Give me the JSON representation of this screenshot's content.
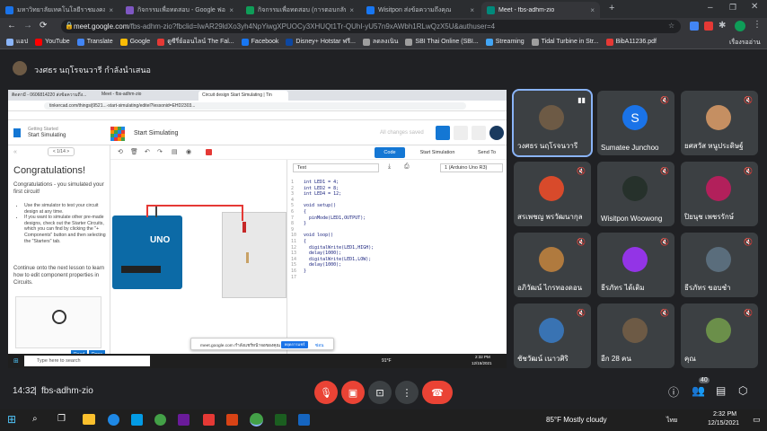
{
  "browser": {
    "tabs": [
      {
        "title": "มหาวิทยาลัยเทคโนโลยีราชมงคลศรีวิชัย",
        "color": "#1a73e8"
      },
      {
        "title": "กิจกรรมเพื่อทดสอบ - Google ฟอร์ม",
        "color": "#7e57c2"
      },
      {
        "title": "กิจกรรมเพื่อทดสอบ (การตอบกลับ) - Go",
        "color": "#0f9d58"
      },
      {
        "title": "Wisitpon ส่งข้อความถึงคุณ",
        "color": "#1877f2"
      },
      {
        "title": "Meet - fbs-adhm-zio",
        "color": "#00897b"
      }
    ],
    "new_tab": "+",
    "url_host": "meet.google.com",
    "url_path": "/fbs-adhm-zio?fbclid=IwAR29ldXo3yh4NpYiwgXPUOCy3XHUQt1Tr-QUhI-yU57n9xAWbh1RLwQzX5U&authuser=4",
    "bookmarks": [
      {
        "label": "แอป",
        "color": "#8ab4f8"
      },
      {
        "label": "YouTube",
        "color": "#ff0000"
      },
      {
        "label": "Translate",
        "color": "#4285f4"
      },
      {
        "label": "Google",
        "color": "#fbbc05"
      },
      {
        "label": "ดูซีรี่ย์ออนไลน์ The Fal...",
        "color": "#e53935"
      },
      {
        "label": "Facebook",
        "color": "#1877f2"
      },
      {
        "label": "Disney+ Hotstar ฟรี...",
        "color": "#0d47a1"
      },
      {
        "label": "ลดลงเนิน",
        "color": "#9e9e9e"
      },
      {
        "label": "SBI Thai Online (SBI...",
        "color": "#9e9e9e"
      },
      {
        "label": "Streaming",
        "color": "#42a5f5"
      },
      {
        "label": "Tidal Turbine in Str...",
        "color": "#9e9e9e"
      },
      {
        "label": "BibA11236.pdf",
        "color": "#e53935"
      }
    ],
    "reading_list": "เรื่องรออ่าน"
  },
  "meet": {
    "presenter_banner": "วงศธร นฤโรจนวารี กำลังนำเสนอ",
    "time": "14:32",
    "meeting_code": "fbs-adhm-zio",
    "participant_count": "40",
    "participants": [
      {
        "name": "วงศธร นฤโรจนวารี",
        "avatar": "photo",
        "color": "#6d5a45",
        "speaking": true
      },
      {
        "name": "Sumatee Junchoo",
        "avatar": "S",
        "color": "#1a73e8"
      },
      {
        "name": "ยศสวัส หนูประดิษฐ์",
        "avatar": "photo",
        "color": "#c58f62"
      },
      {
        "name": "สรเพชญ พรวัฒนากุล",
        "avatar": "photo",
        "color": "#d84a2b"
      },
      {
        "name": "Wisitpon Woowong",
        "avatar": "photo",
        "color": "#26312b"
      },
      {
        "name": "ปิยนุช เพชรรักษ์",
        "avatar": "photo",
        "color": "#b2205b"
      },
      {
        "name": "อภิวัฒน์ ไกรทองดอน",
        "avatar": "photo",
        "color": "#b07a3e"
      },
      {
        "name": "ธีรภัทร ได้เติม",
        "avatar": "photo",
        "color": "#9334e6"
      },
      {
        "name": "ธีรภัทร ขอบชำ",
        "avatar": "photo",
        "color": "#5a6d7c"
      },
      {
        "name": "ชัชวัฒน์ เนาวศิริ",
        "avatar": "photo",
        "color": "#3973b3"
      },
      {
        "name": "อีก 28 คน",
        "avatar": "photo",
        "color": "#6d5a45"
      },
      {
        "name": "คุณ",
        "avatar": "photo",
        "color": "#6b8f4a"
      }
    ]
  },
  "shared": {
    "tabs": [
      {
        "title": "ติดตามี - 0606814220 ส่งข้อความถึง..."
      },
      {
        "title": "Meet - fbs-adhm-zio"
      },
      {
        "title": "Circuit design Start Simulating | Tin"
      }
    ],
    "url": "tinkercad.com/things/j9521...-start-simulating/editel?lessonid=EHD2303...",
    "lesson_label": "Getting Started",
    "lesson_sub": "Start Simulating",
    "project_title": "Start Simulating",
    "saved_status": "All changes saved",
    "page_counter": "< 1/14 >",
    "lesson_heading": "Congratulations!",
    "lesson_intro": "Congratulations - you simulated your first circuit!",
    "bullets": [
      "Use the simulator to test your circuit design at any time.",
      "If you want to simulate other pre-made designs, check out the Starter Circuits, which you can find by clicking the \"+ Components\" button and then selecting the \"Starters\" tab."
    ],
    "lesson_footer": "Continue onto the next lesson to learn how to edit component properties in Circuits.",
    "btn_read": "Read",
    "btn_done": "Done",
    "btn_code": "Code",
    "btn_simulate": "Start Simulation",
    "btn_send": "Send To",
    "code_mode": "Text",
    "board": "1 (Arduino Uno R3)",
    "arduino_label": "UNO",
    "code_lines": [
      "int LED1 = 4;",
      "int LED2 = 8;",
      "int LED4 = 12;",
      "",
      "void setup()",
      "{",
      "  pinMode(LED1,OUTPUT);",
      "}",
      "",
      "void loop()",
      "{",
      "  digitalWrite(LED1,HIGH);",
      "  delay(1000);",
      "  digitalWrite(LED1,LOW);",
      "  delay(1000);",
      "}",
      ""
    ],
    "share_notice": "meet.google.com กำลังแชร์หน้าจอของคุณ",
    "share_stop": "หยุดการแชร์",
    "share_hide": "ซ่อน",
    "search_placeholder": "Type here to search",
    "weather": "91°F",
    "clock_time": "2:32 PM",
    "clock_date": "12/15/2021"
  },
  "taskbar": {
    "weather": "85°F  Mostly cloudy",
    "lang": "ไทย",
    "time": "2:32 PM",
    "date": "12/15/2021"
  }
}
